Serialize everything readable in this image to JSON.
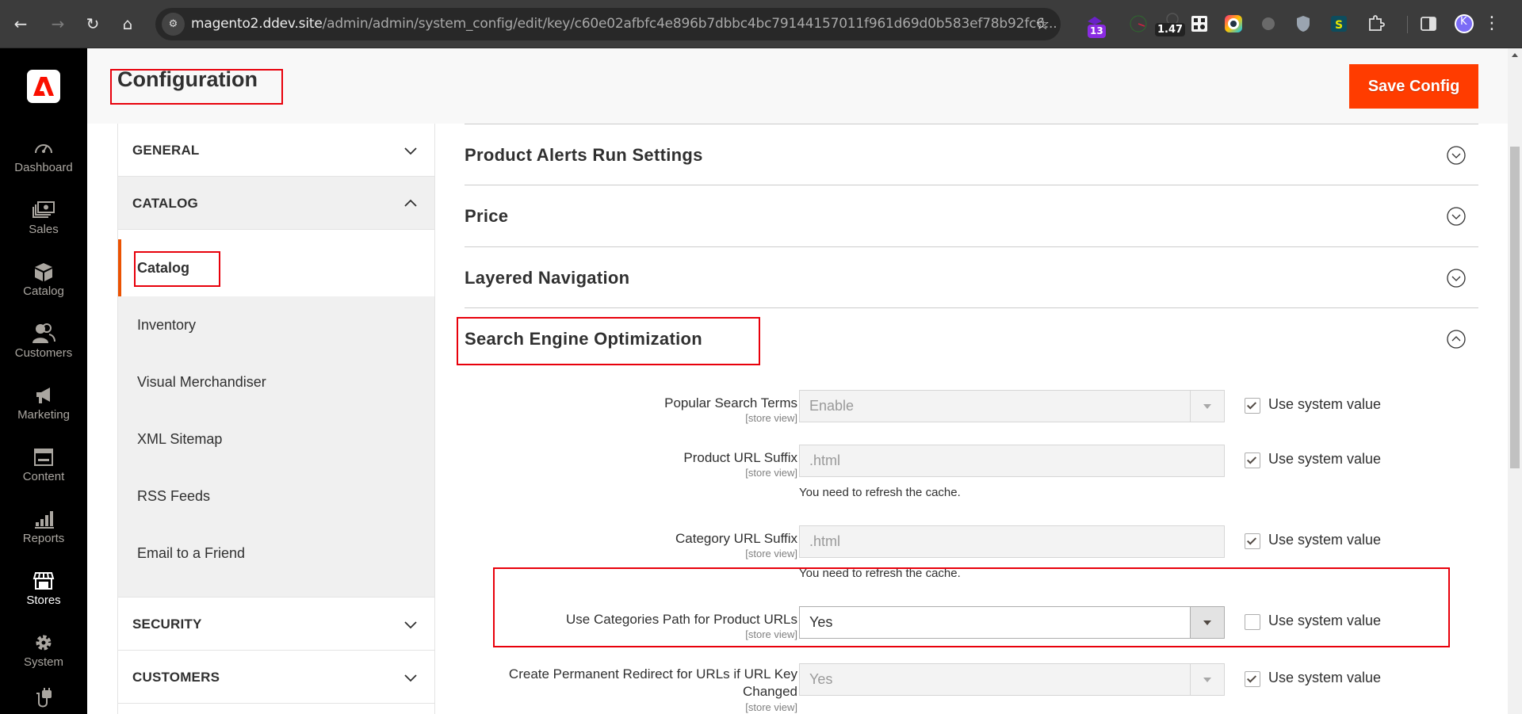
{
  "browser": {
    "url_host": "magento2.ddev.site",
    "url_path": "/admin/admin/system_config/edit/key/c60e02afbfc4e896b7dbbc4bc79144157011f961d69d0b583ef78b92fc6...",
    "extensions": [
      {
        "name": "tab-counter-extension",
        "badge": "13"
      },
      {
        "name": "clock-extension",
        "badge": ""
      },
      {
        "name": "timer-extension",
        "badge": "1.47"
      },
      {
        "name": "qr-code-extension",
        "badge": ""
      },
      {
        "name": "color-picker-extension",
        "badge": ""
      },
      {
        "name": "bug-extension",
        "badge": ""
      },
      {
        "name": "shield-extension",
        "badge": ""
      },
      {
        "name": "ds-extension",
        "badge": ""
      },
      {
        "name": "extensions-puzzle",
        "badge": ""
      }
    ],
    "profile_initial": "K"
  },
  "admin_nav": {
    "items": [
      {
        "label": "Dashboard",
        "icon": "dashboard-icon"
      },
      {
        "label": "Sales",
        "icon": "sales-icon"
      },
      {
        "label": "Catalog",
        "icon": "catalog-icon"
      },
      {
        "label": "Customers",
        "icon": "customers-icon"
      },
      {
        "label": "Marketing",
        "icon": "marketing-icon"
      },
      {
        "label": "Content",
        "icon": "content-icon"
      },
      {
        "label": "Reports",
        "icon": "reports-icon"
      },
      {
        "label": "Stores",
        "icon": "stores-icon",
        "active": true
      },
      {
        "label": "System",
        "icon": "system-icon"
      },
      {
        "label": "",
        "icon": "extensions-icon"
      }
    ]
  },
  "header": {
    "title": "Configuration",
    "save_label": "Save Config"
  },
  "config_tabs": {
    "groups": [
      {
        "title": "GENERAL",
        "expanded": false
      },
      {
        "title": "CATALOG",
        "expanded": true
      },
      {
        "title": "SECURITY",
        "expanded": false
      },
      {
        "title": "CUSTOMERS",
        "expanded": false
      }
    ],
    "catalog_items": [
      {
        "label": "Catalog",
        "active": true
      },
      {
        "label": "Inventory"
      },
      {
        "label": "Visual Merchandiser"
      },
      {
        "label": "XML Sitemap"
      },
      {
        "label": "RSS Feeds"
      },
      {
        "label": "Email to a Friend"
      }
    ]
  },
  "sections": [
    {
      "title": "Product Alerts Run Settings",
      "expanded": false
    },
    {
      "title": "Price",
      "expanded": false
    },
    {
      "title": "Layered Navigation",
      "expanded": false
    },
    {
      "title": "Search Engine Optimization",
      "expanded": true
    }
  ],
  "seo_fields": [
    {
      "label": "Popular Search Terms",
      "scope": "[store view]",
      "type": "select",
      "value": "Enable",
      "use_system_value": true,
      "note": ""
    },
    {
      "label": "Product URL Suffix",
      "scope": "[store view]",
      "type": "text",
      "value": ".html",
      "use_system_value": true,
      "note": "You need to refresh the cache."
    },
    {
      "label": "Category URL Suffix",
      "scope": "[store view]",
      "type": "text",
      "value": ".html",
      "use_system_value": true,
      "note": "You need to refresh the cache."
    },
    {
      "label": "Use Categories Path for Product URLs",
      "scope": "[store view]",
      "type": "select",
      "value": "Yes",
      "use_system_value": false,
      "note": ""
    },
    {
      "label_line1": "Create Permanent Redirect for URLs if URL Key",
      "label_line2": "Changed",
      "scope": "[store view]",
      "type": "select",
      "value": "Yes",
      "use_system_value": true,
      "note": ""
    }
  ],
  "use_system_value_label": "Use system value",
  "colors": {
    "accent": "#ff3c00",
    "active_tab_border": "#eb5202",
    "highlight_box": "#e8000b",
    "admin_nav_bg": "#000000"
  }
}
